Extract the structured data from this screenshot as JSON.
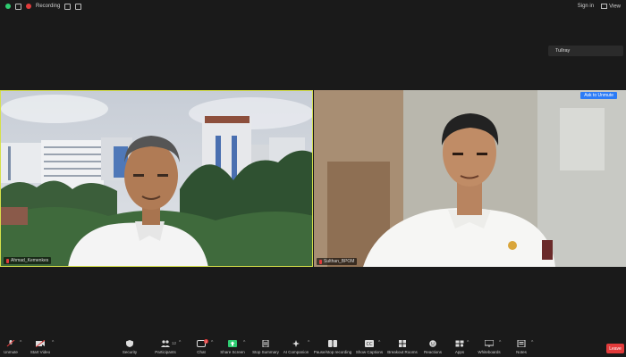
{
  "topbar": {
    "recording_label": "Recording",
    "sign_in_label": "Sign in",
    "view_label": "View"
  },
  "name_pill": {
    "text": "Tullray"
  },
  "tiles": {
    "left": {
      "name": "Ahmad_Kemenkes"
    },
    "right": {
      "name": "Sulthan_BPOM",
      "admin_label": "Ask to Unmute"
    }
  },
  "toolbar": {
    "unmute": "Unmute",
    "start_video": "Start Video",
    "security": "Security",
    "participants": "Participants",
    "participants_count": "12",
    "chat": "Chat",
    "chat_badge": "1",
    "share_screen": "Share Screen",
    "stop_summary": "Stop Summary",
    "ai_companion": "AI Companion",
    "pause_stop_recording": "Pause/stop recording",
    "show_captions": "Show Captions",
    "breakout_rooms": "Breakout Rooms",
    "reactions": "Reactions",
    "apps": "Apps",
    "whiteboards": "Whiteboards",
    "notes": "Notes",
    "leave": "Leave"
  },
  "colors": {
    "accent_share": "#2ecc71",
    "active_border": "#d6e04a",
    "leave": "#e23b3b",
    "admin_btn": "#2d7cf6"
  }
}
